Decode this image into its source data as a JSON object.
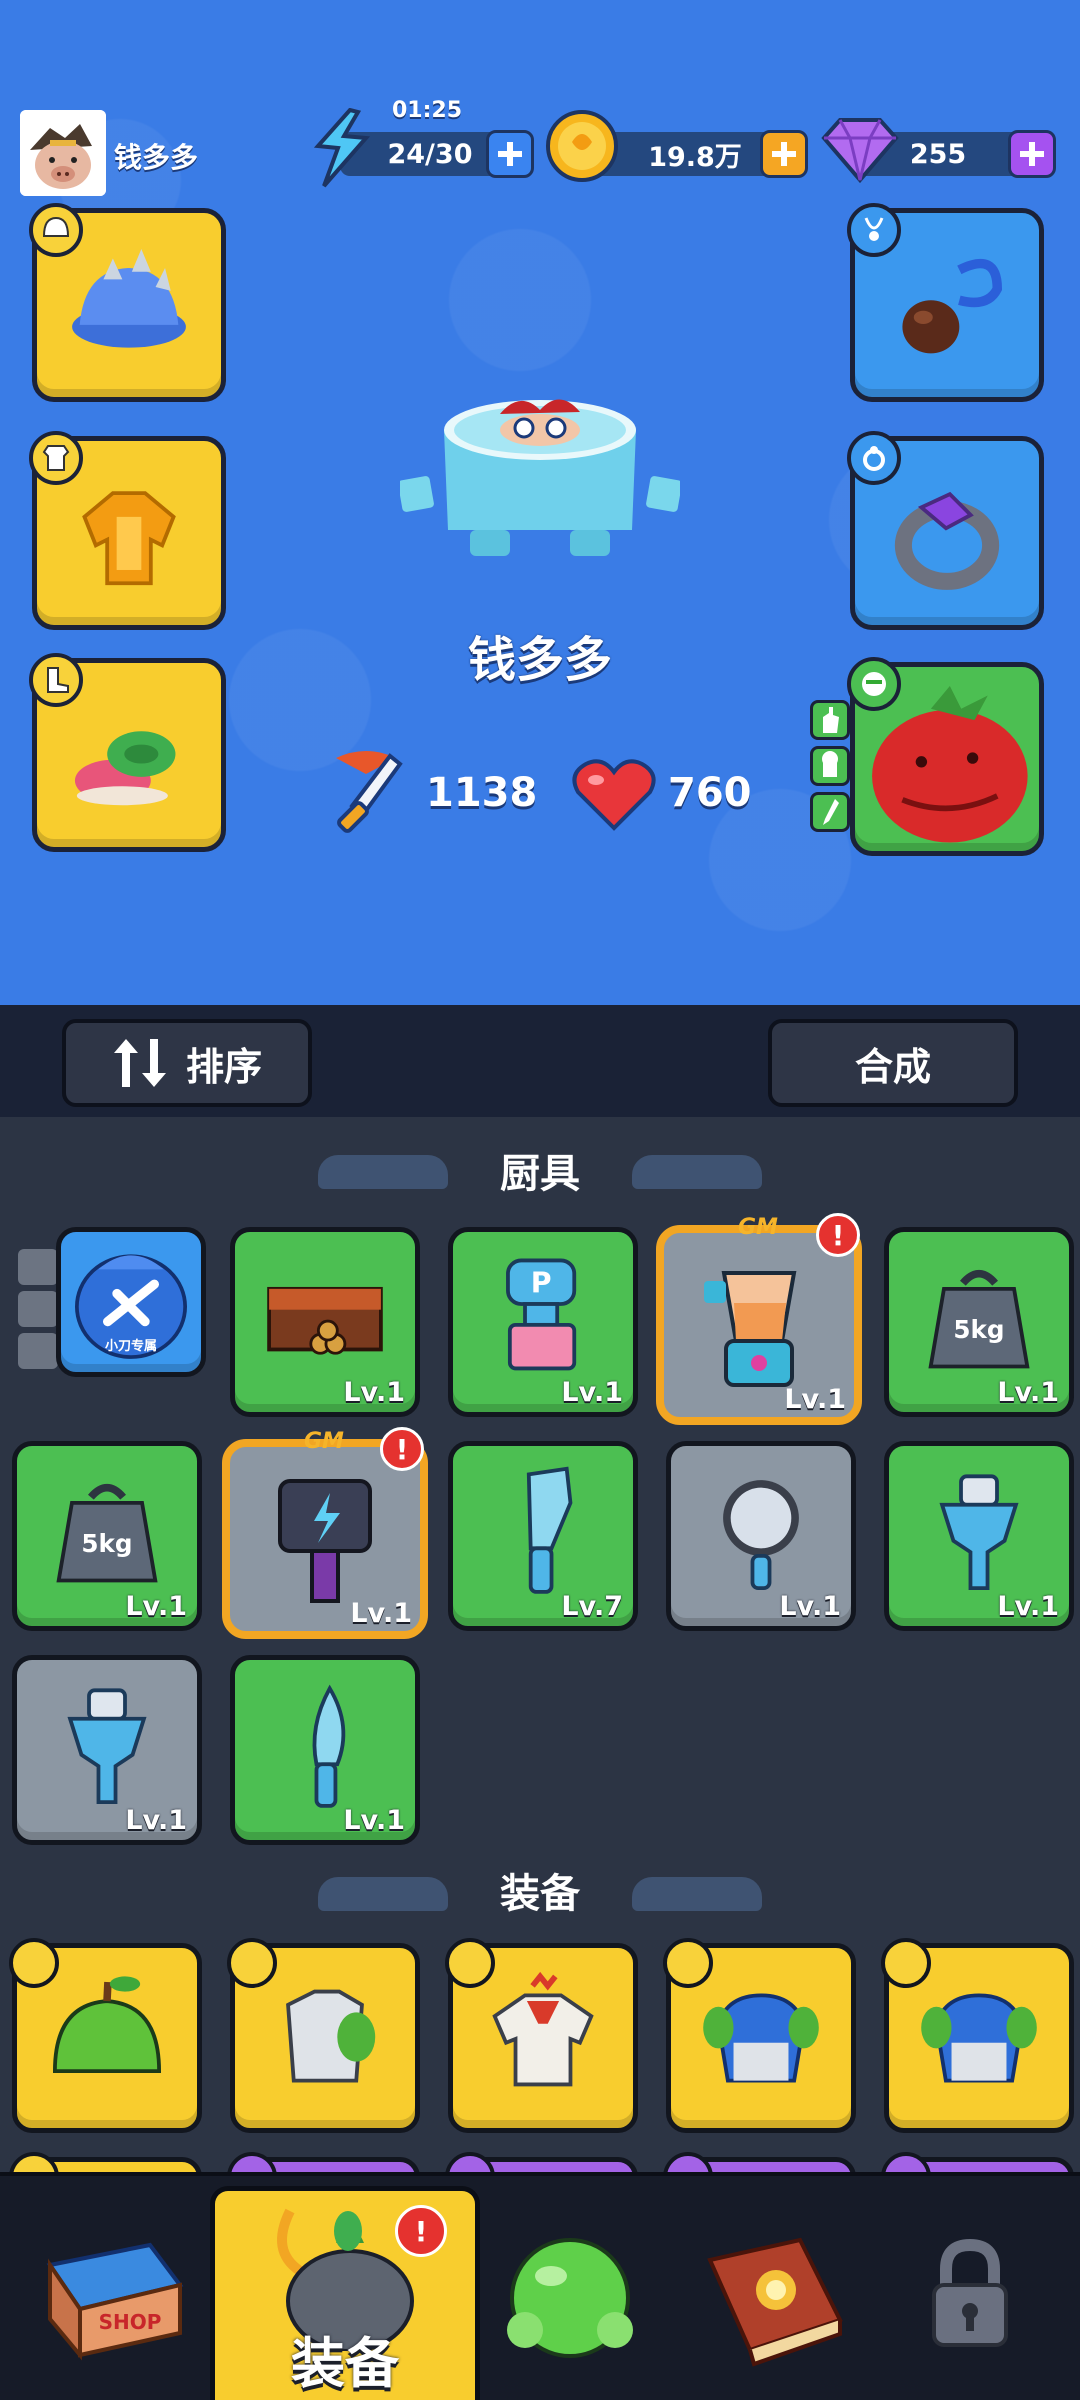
{
  "player": {
    "name": "钱多多"
  },
  "resources": {
    "energy": {
      "timer": "01:25",
      "value": "24/30",
      "icon": "lightning-icon"
    },
    "coins": {
      "value": "19.8万",
      "icon": "coin-icon"
    },
    "gems": {
      "value": "255",
      "icon": "gem-icon"
    }
  },
  "character": {
    "name": "钱多多",
    "attack": "1138",
    "health": "760"
  },
  "actions": {
    "sort_label": "排序",
    "merge_label": "合成"
  },
  "sections": {
    "kitchenware": "厨具",
    "equipment": "装备"
  },
  "kitchenware": [
    {
      "name": "knife-bag",
      "level": "",
      "label": "小刀专属"
    },
    {
      "name": "grill",
      "level": "Lv.1"
    },
    {
      "name": "pepper-mill",
      "level": "Lv.1"
    },
    {
      "name": "blender",
      "level": "Lv.1",
      "gm": "GM"
    },
    {
      "name": "weight",
      "level": "Lv.1",
      "tag": "5kg"
    },
    {
      "name": "weight",
      "level": "Lv.1",
      "tag": "5kg"
    },
    {
      "name": "hammer",
      "level": "Lv.1",
      "gm": "GM"
    },
    {
      "name": "cleaver",
      "level": "Lv.7"
    },
    {
      "name": "pan",
      "level": "Lv.1"
    },
    {
      "name": "grinder",
      "level": "Lv.1"
    },
    {
      "name": "grinder",
      "level": "Lv.1"
    },
    {
      "name": "knife",
      "level": "Lv.1"
    }
  ],
  "alert_mark": "!",
  "nav": {
    "equipment_label": "装备",
    "shop_sign": "SHOP"
  },
  "colors": {
    "sky": "#3a7ce6",
    "yellow": "#f8cd2e",
    "green": "#4cbf52",
    "blue": "#3b98ee",
    "purple": "#a363e6"
  }
}
